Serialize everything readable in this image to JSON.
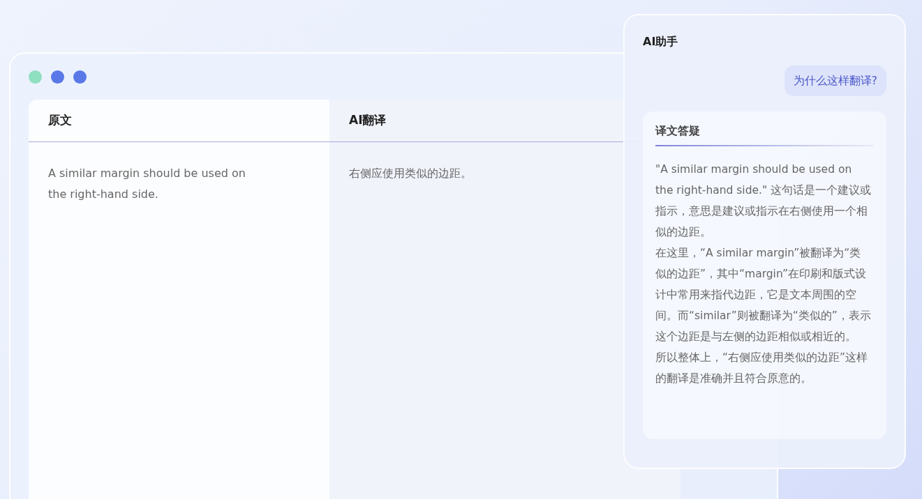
{
  "window": {
    "dots": [
      {
        "color": "#8fe0c0"
      },
      {
        "color": "#5b78e8"
      },
      {
        "color": "#5b78e8"
      }
    ]
  },
  "columns": [
    {
      "header": "原文",
      "text": "A similar margin should be used on the right-hand side."
    },
    {
      "header": "AI翻译",
      "text": "右侧应使用类似的边距。"
    }
  ],
  "assistant": {
    "title": "AI助手",
    "question": "为什么这样翻译?",
    "answer_title": "译文答疑",
    "answer": [
      "\"A similar margin should be used on the right-hand side.\" 这句话是一个建议或指示，意思是建议或指示在右侧使用一个相似的边距。",
      "在这里，“A similar margin”被翻译为“类似的边距”，其中“margin”在印刷和版式设计中常用来指代边距，它是文本周围的空间。而“similar”则被翻译为“类似的”，表示这个边距是与左侧的边距相似或相近的。",
      "所以整体上，“右侧应使用类似的边距”这样的翻译是准确并且符合原意的。"
    ]
  }
}
